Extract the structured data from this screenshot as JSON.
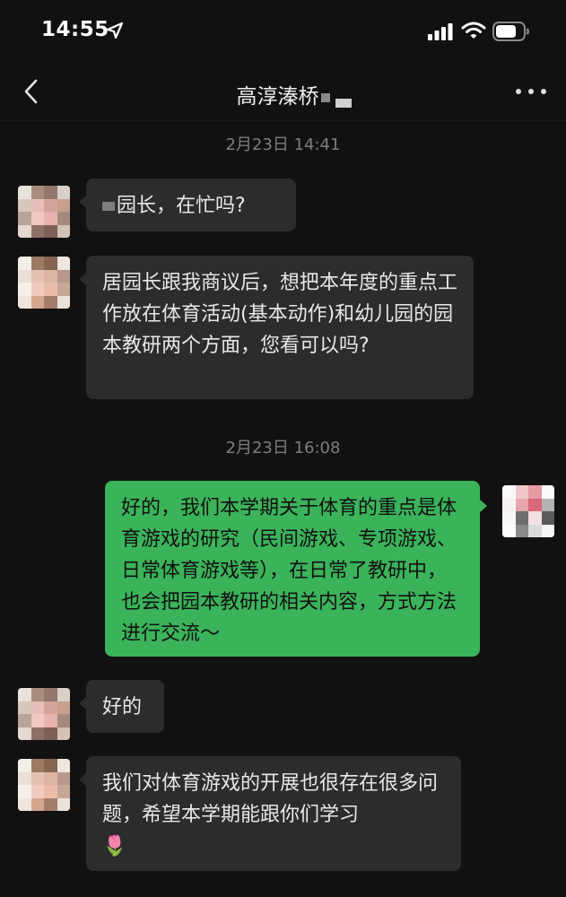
{
  "status_bar": {
    "time": "14:55",
    "icons": [
      "location-arrow-icon",
      "cellular-signal-icon",
      "wifi-icon",
      "battery-icon"
    ]
  },
  "nav": {
    "title": "高淳溱桥",
    "back_icon": "chevron-left-icon",
    "more_icon": "more-dots-icon"
  },
  "colors": {
    "background": "#111111",
    "incoming_bubble": "#2c2c2c",
    "outgoing_bubble": "#3bb35a",
    "timestamp_text": "#7d7d7d"
  },
  "messages": [
    {
      "type": "timestamp",
      "text": "2月23日 14:41"
    },
    {
      "type": "incoming",
      "text": "园长，在忙吗?"
    },
    {
      "type": "incoming",
      "text": "居园长跟我商议后，想把本年度的重点工作放在体育活动(基本动作)和幼儿园的园本教研两个方面，您看可以吗?"
    },
    {
      "type": "timestamp",
      "text": "2月23日 16:08"
    },
    {
      "type": "outgoing",
      "text": "好的，我们本学期关于体育的重点是体育游戏的研究（民间游戏、专项游戏、日常体育游戏等），在日常了教研中，也会把园本教研的相关内容，方式方法进行交流～"
    },
    {
      "type": "incoming",
      "text": "好的"
    },
    {
      "type": "incoming",
      "text": "我们对体育游戏的开展也很存在很多问题，希望本学期能跟你们学习",
      "emoji": "🌷"
    }
  ]
}
